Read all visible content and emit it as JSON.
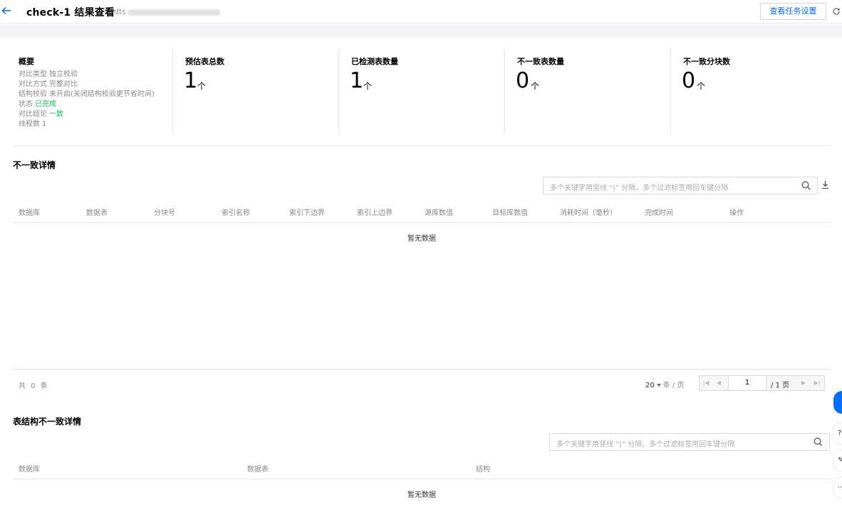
{
  "header": {
    "back_icon": "arrow-left-icon",
    "title": "check-1 结果查看",
    "task_id_prefix": "dts",
    "settings_button": "查看任务设置",
    "refresh_icon": "refresh-icon"
  },
  "overview": {
    "title": "概要",
    "rows": [
      {
        "label": "对比类型",
        "value": "独立校验"
      },
      {
        "label": "对比方式",
        "value": "完整对比"
      },
      {
        "label": "结构校验",
        "value": "未开启(关闭结构校验更节省时间)"
      },
      {
        "label": "状态",
        "value": "已完成"
      },
      {
        "label": "对比结论",
        "value": "一致"
      },
      {
        "label": "线程数",
        "value": "1"
      }
    ]
  },
  "stats": [
    {
      "label": "预估表总数",
      "value": "1",
      "unit": "个"
    },
    {
      "label": "已检测表数量",
      "value": "1",
      "unit": "个"
    },
    {
      "label": "不一致表数量",
      "value": "0",
      "unit": "个"
    },
    {
      "label": "不一致分块数",
      "value": "0",
      "unit": "个"
    }
  ],
  "inconsistency": {
    "title": "不一致详情",
    "search_placeholder": "多个关键字用竖线 “|” 分隔，多个过滤标签用回车键分隔",
    "columns": [
      "数据库",
      "数据表",
      "分块号",
      "索引名称",
      "索引下边界",
      "索引上边界",
      "源库数值",
      "目标库数值",
      "消耗时间（毫秒）",
      "完成时间",
      "操作"
    ],
    "empty": "暂无数据",
    "total": "共 0 条",
    "page_size": "20",
    "per_page": "条 / 页",
    "current_page": "1",
    "page_total": "/ 1 页"
  },
  "structure": {
    "title": "表结构不一致详情",
    "search_placeholder": "多个关键字用竖线 “|” 分隔，多个过滤标签用回车键分隔",
    "columns": [
      "数据库",
      "数据表",
      "结构"
    ],
    "empty": "暂无数据"
  },
  "colors": {
    "accent": "#006eff",
    "success": "#0abf5b"
  }
}
